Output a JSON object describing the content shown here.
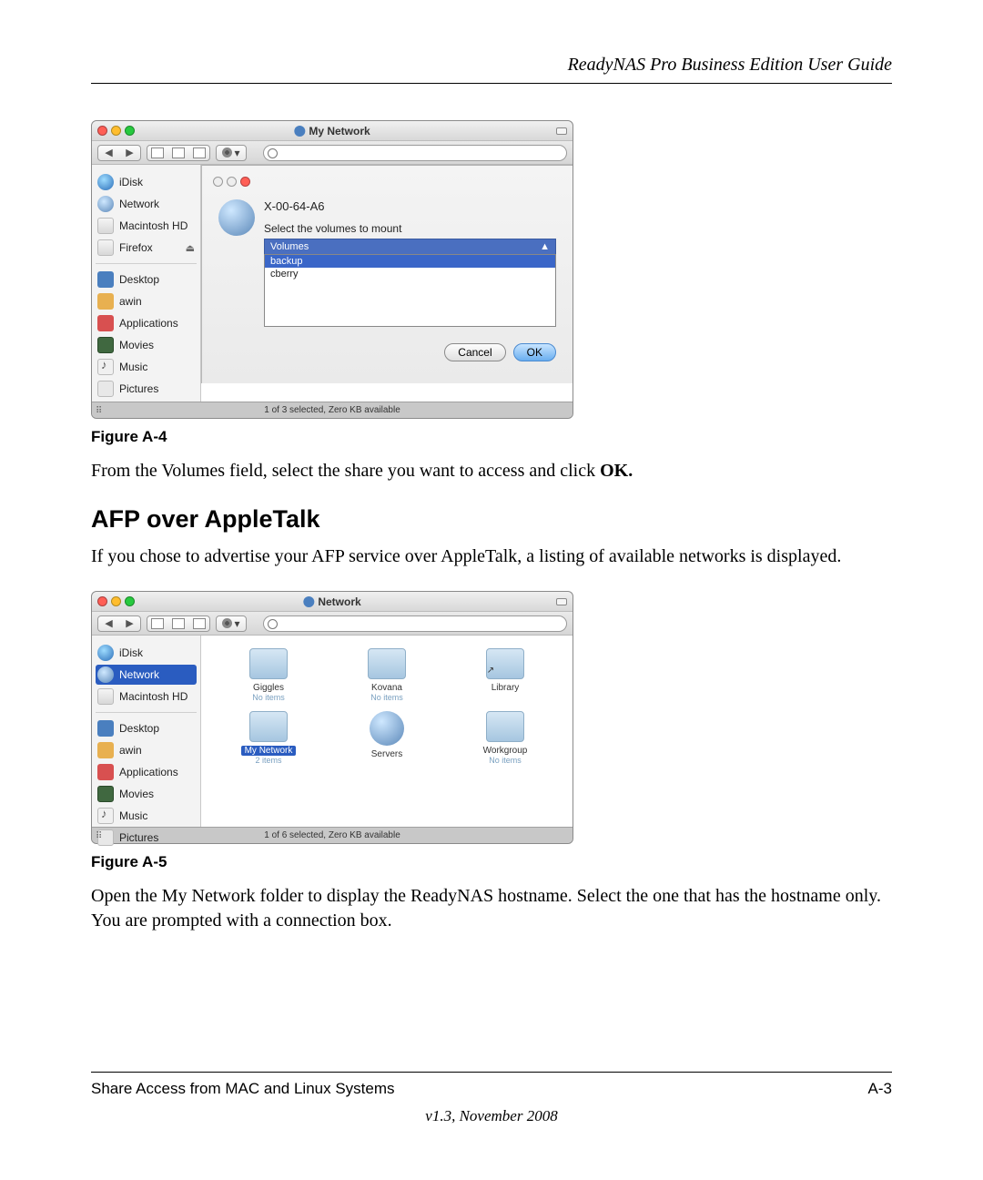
{
  "header": {
    "title": "ReadyNAS Pro Business Edition User Guide"
  },
  "figA4": {
    "label": "Figure A-4",
    "window_title": "My Network",
    "sidebar": {
      "items": [
        {
          "label": "iDisk",
          "icon": "ic-idisk"
        },
        {
          "label": "Network",
          "icon": "ic-net"
        },
        {
          "label": "Macintosh HD",
          "icon": "ic-hd"
        },
        {
          "label": "Firefox",
          "icon": "ic-hd",
          "eject": true
        }
      ],
      "items2": [
        {
          "label": "Desktop",
          "icon": "ic-desk"
        },
        {
          "label": "awin",
          "icon": "ic-home"
        },
        {
          "label": "Applications",
          "icon": "ic-apps"
        },
        {
          "label": "Movies",
          "icon": "ic-mov"
        },
        {
          "label": "Music",
          "icon": "ic-music"
        },
        {
          "label": "Pictures",
          "icon": "ic-pics"
        }
      ]
    },
    "sheet": {
      "host": "X-00-64-A6",
      "prompt": "Select the volumes to mount",
      "col_header": "Volumes",
      "items": [
        "backup",
        "cberry"
      ],
      "cancel": "Cancel",
      "ok": "OK"
    },
    "status": "1 of 3 selected, Zero KB available"
  },
  "para1": {
    "pre": "From the Volumes field, select the share you want to access and click ",
    "bold": "OK."
  },
  "section_title": "AFP over AppleTalk",
  "para2": "If you chose to advertise your AFP service over AppleTalk, a listing of available networks is displayed.",
  "figA5": {
    "label": "Figure A-5",
    "window_title": "Network",
    "sidebar": {
      "items": [
        {
          "label": "iDisk",
          "icon": "ic-idisk"
        },
        {
          "label": "Network",
          "icon": "ic-net",
          "hl": true
        },
        {
          "label": "Macintosh HD",
          "icon": "ic-hd"
        }
      ],
      "items2": [
        {
          "label": "Desktop",
          "icon": "ic-desk"
        },
        {
          "label": "awin",
          "icon": "ic-home"
        },
        {
          "label": "Applications",
          "icon": "ic-apps"
        },
        {
          "label": "Movies",
          "icon": "ic-mov"
        },
        {
          "label": "Music",
          "icon": "ic-music"
        },
        {
          "label": "Pictures",
          "icon": "ic-pics"
        }
      ]
    },
    "grid": [
      {
        "name": "Giggles",
        "sub": "No items",
        "type": "folder"
      },
      {
        "name": "Kovana",
        "sub": "No items",
        "type": "folder"
      },
      {
        "name": "Library",
        "sub": "",
        "type": "folder-alias"
      },
      {
        "name": "My Network",
        "sub": "2 items",
        "type": "folder",
        "selected": true
      },
      {
        "name": "Servers",
        "sub": "",
        "type": "globe"
      },
      {
        "name": "Workgroup",
        "sub": "No items",
        "type": "folder"
      }
    ],
    "status": "1 of 6 selected, Zero KB available"
  },
  "para3": "Open the My Network folder to display the ReadyNAS hostname. Select the one that has the hostname only. You are prompted with a connection box.",
  "footer": {
    "left": "Share Access from MAC and Linux Systems",
    "right": "A-3",
    "version": "v1.3, November 2008"
  }
}
